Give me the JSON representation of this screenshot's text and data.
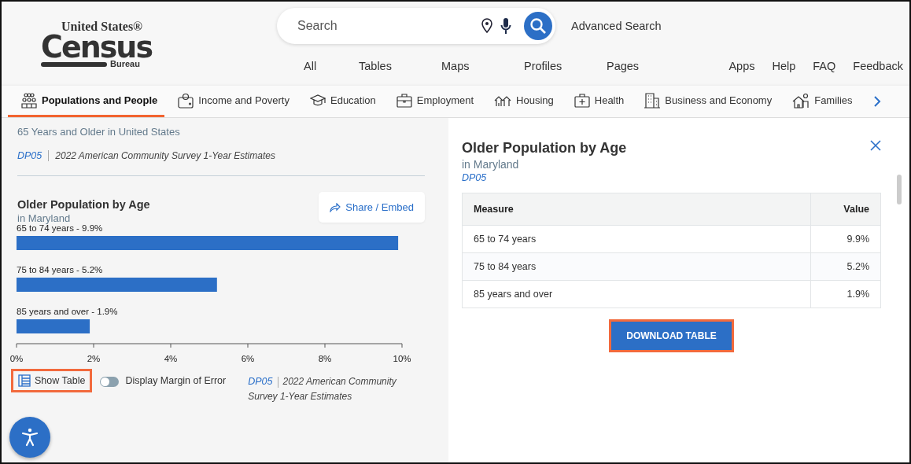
{
  "logo": {
    "line_1": "United States®",
    "line_2": "Census",
    "line_3": "Bureau"
  },
  "search": {
    "placeholder": "Search"
  },
  "advanced_search": "Advanced Search",
  "nav_left": [
    "All",
    "Tables",
    "Maps",
    "Profiles",
    "Pages"
  ],
  "nav_right": [
    "Apps",
    "Help",
    "FAQ",
    "Feedback"
  ],
  "topic_tabs": [
    {
      "label": "Populations and People",
      "kind": "people",
      "selected": true
    },
    {
      "label": "Income and Poverty",
      "kind": "wallet",
      "selected": false
    },
    {
      "label": "Education",
      "kind": "cap",
      "selected": false
    },
    {
      "label": "Employment",
      "kind": "briefcase",
      "selected": false
    },
    {
      "label": "Housing",
      "kind": "houses",
      "selected": false
    },
    {
      "label": "Health",
      "kind": "kit",
      "selected": false
    },
    {
      "label": "Business and Economy",
      "kind": "building",
      "selected": false
    },
    {
      "label": "Families",
      "kind": "family",
      "selected": false
    }
  ],
  "left_panel": {
    "stat_caption": "65 Years and Older in United States",
    "source_code": "DP05",
    "source_name": "2022 American Community Survey 1-Year Estimates",
    "chart_title": "Older Population by Age",
    "chart_subtitle": "in Maryland",
    "share_button": "Share / Embed",
    "chart_data": {
      "type": "bar",
      "orientation": "horizontal",
      "categories": [
        "65 to 74 years - 9.9%",
        "75 to 84 years - 5.2%",
        "85 years and over - 1.9%"
      ],
      "values": [
        9.9,
        5.2,
        1.9
      ],
      "xlim": [
        0,
        10
      ],
      "xticks": [
        {
          "value": 0,
          "label": "0%"
        },
        {
          "value": 2,
          "label": "2%"
        },
        {
          "value": 4,
          "label": "4%"
        },
        {
          "value": 6,
          "label": "6%"
        },
        {
          "value": 8,
          "label": "8%"
        },
        {
          "value": 10,
          "label": "10%"
        }
      ]
    },
    "show_table": {
      "label": "Show Table",
      "highlighted": true
    },
    "margin_toggle": {
      "label": "Display Margin of Error",
      "on": false
    },
    "footer_code": "DP05",
    "footer_source": "2022 American Community Survey 1-Year Estimates"
  },
  "right_panel": {
    "title": "Older Population by Age",
    "subtitle": "in Maryland",
    "code": "DP05",
    "table": {
      "columns": [
        "Measure",
        "Value"
      ],
      "rows": [
        [
          "65 to 74 years",
          "9.9%"
        ],
        [
          "75 to 84 years",
          "5.2%"
        ],
        [
          "85 years and over",
          "1.9%"
        ]
      ]
    },
    "download_button": {
      "label": "DOWNLOAD TABLE",
      "highlighted": true
    }
  }
}
